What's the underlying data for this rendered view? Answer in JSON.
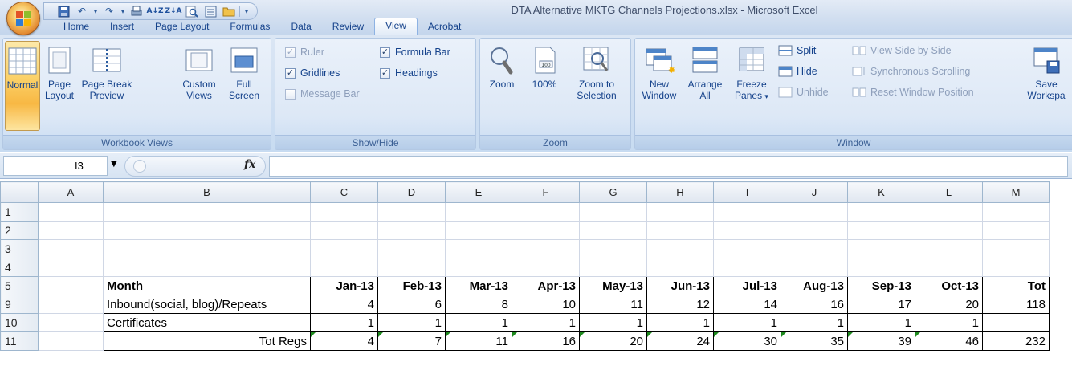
{
  "window": {
    "title": "DTA Alternative MKTG Channels Projections.xlsx - Microsoft Excel"
  },
  "quick_access": [
    "save-icon",
    "undo-icon",
    "redo-icon",
    "print-preview-icon",
    "sort-asc-icon",
    "sort-desc-icon",
    "zoom-icon",
    "form-icon",
    "open-icon"
  ],
  "tabs": [
    {
      "label": "Home",
      "active": false
    },
    {
      "label": "Insert",
      "active": false
    },
    {
      "label": "Page Layout",
      "active": false
    },
    {
      "label": "Formulas",
      "active": false
    },
    {
      "label": "Data",
      "active": false
    },
    {
      "label": "Review",
      "active": false
    },
    {
      "label": "View",
      "active": true
    },
    {
      "label": "Acrobat",
      "active": false
    }
  ],
  "ribbon": {
    "workbook_views": {
      "label": "Workbook Views",
      "normal": "Normal",
      "page_layout_1": "Page",
      "page_layout_2": "Layout",
      "page_break_1": "Page Break",
      "page_break_2": "Preview",
      "custom_views_1": "Custom",
      "custom_views_2": "Views",
      "full_screen_1": "Full",
      "full_screen_2": "Screen"
    },
    "show_hide": {
      "label": "Show/Hide",
      "ruler": "Ruler",
      "gridlines": "Gridlines",
      "message_bar": "Message Bar",
      "formula_bar": "Formula Bar",
      "headings": "Headings"
    },
    "zoom": {
      "label": "Zoom",
      "zoom": "Zoom",
      "hundred": "100%",
      "zoom_sel_1": "Zoom to",
      "zoom_sel_2": "Selection"
    },
    "window": {
      "label": "Window",
      "new_window_1": "New",
      "new_window_2": "Window",
      "arrange_all_1": "Arrange",
      "arrange_all_2": "All",
      "freeze_1": "Freeze",
      "freeze_2": "Panes",
      "split": "Split",
      "hide": "Hide",
      "unhide": "Unhide",
      "side_by_side": "View Side by Side",
      "sync_scroll": "Synchronous Scrolling",
      "reset_pos": "Reset Window Position",
      "save_ws_1": "Save",
      "save_ws_2": "Workspa"
    }
  },
  "formula_bar": {
    "name_box": "I3",
    "fx": "fx",
    "formula": ""
  },
  "sheet": {
    "columns": [
      "A",
      "B",
      "C",
      "D",
      "E",
      "F",
      "G",
      "H",
      "I",
      "J",
      "K",
      "L",
      "M"
    ],
    "rows": [
      {
        "num": "1",
        "cells": [
          "",
          "",
          "",
          "",
          "",
          "",
          "",
          "",
          "",
          "",
          "",
          "",
          ""
        ]
      },
      {
        "num": "2",
        "cells": [
          "",
          "",
          "",
          "",
          "",
          "",
          "",
          "",
          "",
          "",
          "",
          "",
          ""
        ]
      },
      {
        "num": "3",
        "cells": [
          "",
          "",
          "",
          "",
          "",
          "",
          "",
          "",
          "",
          "",
          "",
          "",
          ""
        ]
      },
      {
        "num": "4",
        "cells": [
          "",
          "",
          "",
          "",
          "",
          "",
          "",
          "",
          "",
          "",
          "",
          "",
          ""
        ]
      },
      {
        "num": "5",
        "cells": [
          "",
          "Month",
          "Jan-13",
          "Feb-13",
          "Mar-13",
          "Apr-13",
          "May-13",
          "Jun-13",
          "Jul-13",
          "Aug-13",
          "Sep-13",
          "Oct-13",
          "Tot"
        ]
      },
      {
        "num": "9",
        "cells": [
          "",
          "Inbound(social, blog)/Repeats",
          "4",
          "6",
          "8",
          "10",
          "11",
          "12",
          "14",
          "16",
          "17",
          "20",
          "118"
        ]
      },
      {
        "num": "10",
        "cells": [
          "",
          "Certificates",
          "1",
          "1",
          "1",
          "1",
          "1",
          "1",
          "1",
          "1",
          "1",
          "1",
          ""
        ]
      },
      {
        "num": "11",
        "cells": [
          "",
          "Tot Regs",
          "4",
          "7",
          "11",
          "16",
          "20",
          "24",
          "30",
          "35",
          "39",
          "46",
          "232"
        ]
      }
    ]
  }
}
